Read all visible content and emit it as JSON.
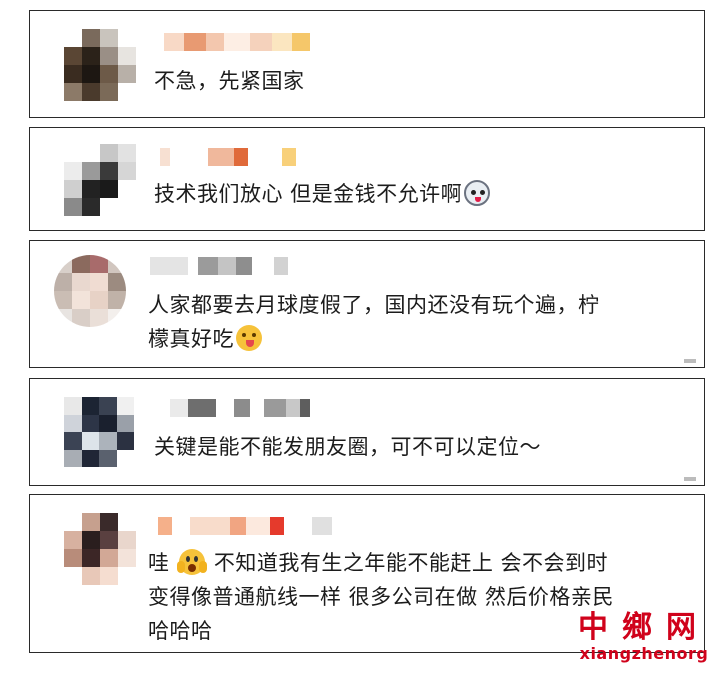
{
  "comments": [
    {
      "text": "不急，先紧国家",
      "emoji": ""
    },
    {
      "text": "技术我们放心 但是金钱不允许啊",
      "emoji": "husky-face-icon"
    },
    {
      "text": "人家都要去月球度假了，国内还没有玩个遍，柠",
      "text2": "檬真好吃",
      "emoji": "face-with-tongue-icon"
    },
    {
      "text": "关键是能不能发朋友圈，可不可以定位～",
      "emoji": ""
    },
    {
      "text_a": "哇",
      "emoji": "fearful-face-icon",
      "text_b": "不知道我有生之年能不能赶上 会不会到时",
      "text2": "变得像普通航线一样 很多公司在做 然后价格亲民",
      "text3": "哈哈哈"
    }
  ],
  "watermark": {
    "cn": "中鄉网",
    "en": "xiangzhenorg"
  },
  "colors": {
    "watermark": "#d0021b",
    "border": "#2a2a2a",
    "text": "#1c1c1c"
  }
}
